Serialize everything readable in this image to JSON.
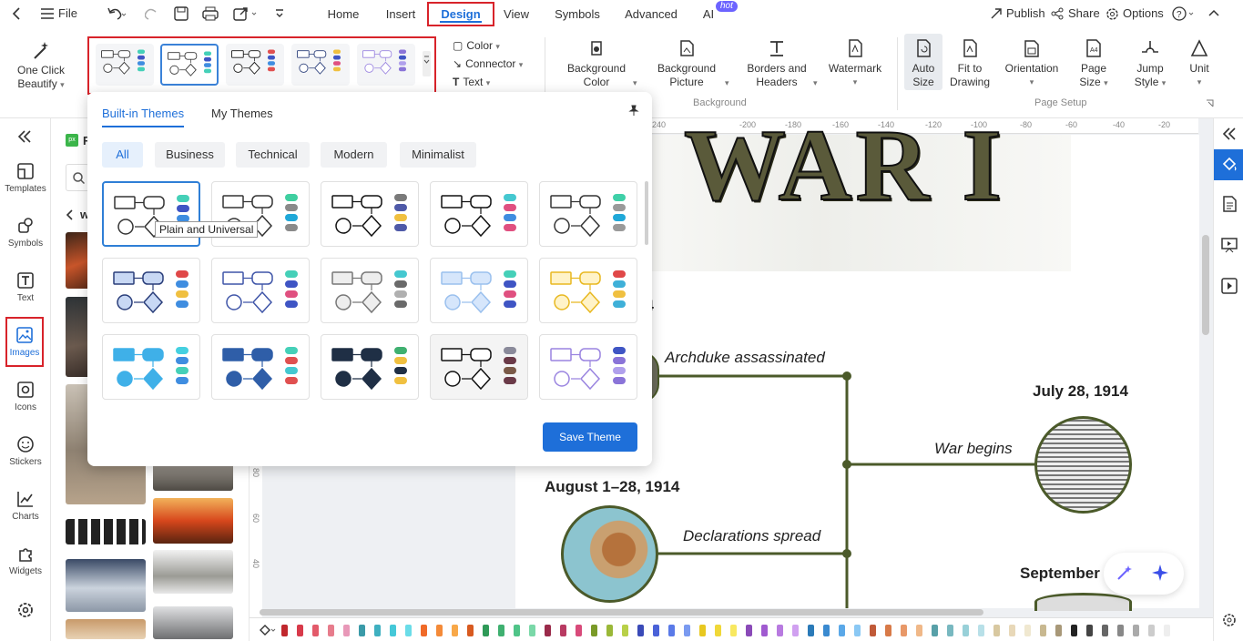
{
  "topbar": {
    "file": "File",
    "publish": "Publish",
    "share": "Share",
    "options": "Options"
  },
  "menu": {
    "tabs": [
      "Home",
      "Insert",
      "Design",
      "View",
      "Symbols",
      "Advanced",
      "AI"
    ],
    "hot": "hot"
  },
  "ribbon": {
    "one_click_l1": "One Click",
    "one_click_l2": "Beautify",
    "color": "Color",
    "connector": "Connector",
    "text": "Text",
    "bg_color_l1": "Background",
    "bg_color_l2": "Color",
    "bg_picture_l1": "Background",
    "bg_picture_l2": "Picture",
    "borders_l1": "Borders and",
    "borders_l2": "Headers",
    "watermark": "Watermark",
    "auto_size_l1": "Auto",
    "auto_size_l2": "Size",
    "fit_l1": "Fit to",
    "fit_l2": "Drawing",
    "orientation": "Orientation",
    "page_size_l1": "Page",
    "page_size_l2": "Size",
    "jump_l1": "Jump",
    "jump_l2": "Style",
    "unit": "Unit",
    "group_background": "Background",
    "group_page_setup": "Page Setup"
  },
  "leftrail": [
    "Templates",
    "Symbols",
    "Text",
    "Images",
    "Icons",
    "Stickers",
    "Charts",
    "Widgets"
  ],
  "library": {
    "px_label": "F",
    "back_label": "w"
  },
  "panel": {
    "tab_builtin": "Built-in Themes",
    "tab_my": "My Themes",
    "filters": [
      "All",
      "Business",
      "Technical",
      "Modern",
      "Minimalist"
    ],
    "tooltip": "Plain and Universal",
    "save_button": "Save Theme"
  },
  "ruler": [
    "240",
    "-200",
    "-180",
    "-160",
    "-140",
    "-120",
    "-100",
    "-80",
    "-60",
    "-40",
    "-20"
  ],
  "ruler_left": [
    "80",
    "60",
    "40"
  ],
  "canvas": {
    "title": "WAR I",
    "year_fragment": "14",
    "events": [
      "Archduke assassinated",
      "War begins",
      "Declarations spread"
    ],
    "dates": [
      "July 28, 1914",
      "August 1–28, 1914",
      "September"
    ]
  },
  "colors": {
    "accent": "#1e6fd9",
    "highlight": "#d8232a",
    "timeline": "#4b5a2a"
  }
}
